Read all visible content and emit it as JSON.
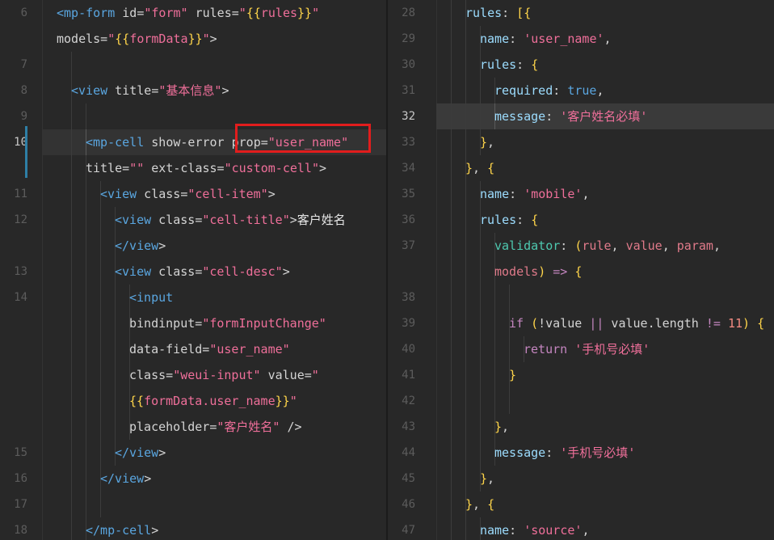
{
  "left": {
    "lines": [
      {
        "ln": "6",
        "active": false,
        "indent": 0,
        "tokens": [
          [
            "tag",
            "<mp-form"
          ],
          [
            "attr",
            " id="
          ],
          [
            "str",
            "\"form\""
          ],
          [
            "attr",
            " rules="
          ],
          [
            "str",
            "\""
          ],
          [
            "brace",
            "{{"
          ],
          [
            "str",
            "rules"
          ],
          [
            "brace",
            "}}"
          ],
          [
            "str",
            "\""
          ]
        ]
      },
      {
        "ln": "",
        "active": false,
        "indent": 0,
        "tokens": [
          [
            "attr",
            "models="
          ],
          [
            "str",
            "\""
          ],
          [
            "brace",
            "{{"
          ],
          [
            "str",
            "formData"
          ],
          [
            "brace",
            "}}"
          ],
          [
            "str",
            "\""
          ],
          [
            "punc",
            ">"
          ]
        ]
      },
      {
        "ln": "7",
        "active": false,
        "indent": 1,
        "tokens": []
      },
      {
        "ln": "8",
        "active": false,
        "indent": 1,
        "tokens": [
          [
            "tag",
            "<view"
          ],
          [
            "attr",
            " title="
          ],
          [
            "str",
            "\"基本信息\""
          ],
          [
            "punc",
            ">"
          ]
        ]
      },
      {
        "ln": "9",
        "active": false,
        "indent": 2,
        "tokens": []
      },
      {
        "ln": "10",
        "active": true,
        "indent": 2,
        "tokens": [
          [
            "tag",
            "<mp-cell"
          ],
          [
            "attr",
            " show-error "
          ],
          [
            "attr",
            "prop="
          ],
          [
            "str",
            "\"user_name\""
          ]
        ]
      },
      {
        "ln": "",
        "active": false,
        "indent": 2,
        "tokens": [
          [
            "attr",
            "title="
          ],
          [
            "str",
            "\"\""
          ],
          [
            "attr",
            " ext-class="
          ],
          [
            "str",
            "\"custom-cell\""
          ],
          [
            "punc",
            ">"
          ]
        ]
      },
      {
        "ln": "11",
        "active": false,
        "indent": 3,
        "tokens": [
          [
            "tag",
            "<view"
          ],
          [
            "attr",
            " class="
          ],
          [
            "str",
            "\"cell-item\""
          ],
          [
            "punc",
            ">"
          ]
        ]
      },
      {
        "ln": "12",
        "active": false,
        "indent": 4,
        "tokens": [
          [
            "tag",
            "<view"
          ],
          [
            "attr",
            " class="
          ],
          [
            "str",
            "\"cell-title\""
          ],
          [
            "punc",
            ">"
          ],
          [
            "cn",
            "客户姓名"
          ]
        ]
      },
      {
        "ln": "",
        "active": false,
        "indent": 4,
        "tokens": [
          [
            "tag",
            "</view"
          ],
          [
            "punc",
            ">"
          ]
        ]
      },
      {
        "ln": "13",
        "active": false,
        "indent": 4,
        "tokens": [
          [
            "tag",
            "<view"
          ],
          [
            "attr",
            " class="
          ],
          [
            "str",
            "\"cell-desc\""
          ],
          [
            "punc",
            ">"
          ]
        ]
      },
      {
        "ln": "14",
        "active": false,
        "indent": 5,
        "tokens": [
          [
            "tag",
            "<input"
          ]
        ]
      },
      {
        "ln": "",
        "active": false,
        "indent": 5,
        "tokens": [
          [
            "attr",
            "bindinput="
          ],
          [
            "str",
            "\"formInputChange\""
          ]
        ]
      },
      {
        "ln": "",
        "active": false,
        "indent": 5,
        "tokens": [
          [
            "attr",
            "data-field="
          ],
          [
            "str",
            "\"user_name\""
          ]
        ]
      },
      {
        "ln": "",
        "active": false,
        "indent": 5,
        "tokens": [
          [
            "attr",
            "class="
          ],
          [
            "str",
            "\"weui-input\""
          ],
          [
            "attr",
            " value="
          ],
          [
            "str",
            "\""
          ]
        ]
      },
      {
        "ln": "",
        "active": false,
        "indent": 5,
        "tokens": [
          [
            "brace",
            "{{"
          ],
          [
            "str",
            "formData.user_name"
          ],
          [
            "brace",
            "}}"
          ],
          [
            "str",
            "\""
          ]
        ]
      },
      {
        "ln": "",
        "active": false,
        "indent": 5,
        "tokens": [
          [
            "attr",
            "placeholder="
          ],
          [
            "str",
            "\"客户姓名\""
          ],
          [
            "punc",
            " />"
          ]
        ]
      },
      {
        "ln": "15",
        "active": false,
        "indent": 4,
        "tokens": [
          [
            "tag",
            "</view"
          ],
          [
            "punc",
            ">"
          ]
        ]
      },
      {
        "ln": "16",
        "active": false,
        "indent": 3,
        "tokens": [
          [
            "tag",
            "</view"
          ],
          [
            "punc",
            ">"
          ]
        ]
      },
      {
        "ln": "17",
        "active": false,
        "indent": 3,
        "tokens": []
      },
      {
        "ln": "18",
        "active": false,
        "indent": 2,
        "tokens": [
          [
            "tag",
            "</mp-cell"
          ],
          [
            "punc",
            ">"
          ]
        ]
      }
    ]
  },
  "right": {
    "lines": [
      {
        "ln": "28",
        "active": false,
        "indent": 2,
        "tokens": [
          [
            "prop",
            "rules"
          ],
          [
            "punc",
            ": "
          ],
          [
            "brace",
            "[{"
          ]
        ]
      },
      {
        "ln": "29",
        "active": false,
        "indent": 3,
        "tokens": [
          [
            "prop",
            "name"
          ],
          [
            "punc",
            ": "
          ],
          [
            "str",
            "'user_name'"
          ],
          [
            "punc",
            ","
          ]
        ]
      },
      {
        "ln": "30",
        "active": false,
        "indent": 3,
        "tokens": [
          [
            "prop",
            "rules"
          ],
          [
            "punc",
            ": "
          ],
          [
            "brace",
            "{"
          ]
        ]
      },
      {
        "ln": "31",
        "active": false,
        "indent": 4,
        "tokens": [
          [
            "prop",
            "required"
          ],
          [
            "punc",
            ": "
          ],
          [
            "bool",
            "true"
          ],
          [
            "punc",
            ","
          ]
        ]
      },
      {
        "ln": "32",
        "active": true,
        "indent": 4,
        "tokens": [
          [
            "prop",
            "message"
          ],
          [
            "punc",
            ": "
          ],
          [
            "str",
            "'客户姓名必填'"
          ]
        ]
      },
      {
        "ln": "33",
        "active": false,
        "indent": 3,
        "tokens": [
          [
            "brace",
            "}"
          ],
          [
            "punc",
            ","
          ]
        ]
      },
      {
        "ln": "34",
        "active": false,
        "indent": 2,
        "tokens": [
          [
            "brace",
            "}"
          ],
          [
            "punc",
            ", "
          ],
          [
            "brace",
            "{"
          ]
        ]
      },
      {
        "ln": "35",
        "active": false,
        "indent": 3,
        "tokens": [
          [
            "prop",
            "name"
          ],
          [
            "punc",
            ": "
          ],
          [
            "str",
            "'mobile'"
          ],
          [
            "punc",
            ","
          ]
        ]
      },
      {
        "ln": "36",
        "active": false,
        "indent": 3,
        "tokens": [
          [
            "prop",
            "rules"
          ],
          [
            "punc",
            ": "
          ],
          [
            "brace",
            "{"
          ]
        ]
      },
      {
        "ln": "37",
        "active": false,
        "indent": 4,
        "tokens": [
          [
            "fn",
            "validator"
          ],
          [
            "punc",
            ": "
          ],
          [
            "brace",
            "("
          ],
          [
            "param",
            "rule"
          ],
          [
            "punc",
            ", "
          ],
          [
            "param",
            "value"
          ],
          [
            "punc",
            ", "
          ],
          [
            "param",
            "param"
          ],
          [
            "punc",
            ","
          ]
        ]
      },
      {
        "ln": "",
        "active": false,
        "indent": 4,
        "tokens": [
          [
            "param",
            "models"
          ],
          [
            "brace",
            ")"
          ],
          [
            "kw",
            " => "
          ],
          [
            "brace",
            "{"
          ]
        ]
      },
      {
        "ln": "38",
        "active": false,
        "indent": 5,
        "tokens": []
      },
      {
        "ln": "39",
        "active": false,
        "indent": 5,
        "tokens": [
          [
            "kw",
            "if"
          ],
          [
            "punc",
            " "
          ],
          [
            "brace",
            "("
          ],
          [
            "punc",
            "!value "
          ],
          [
            "kw",
            "||"
          ],
          [
            "punc",
            " value.length "
          ],
          [
            "kw",
            "!="
          ],
          [
            "punc",
            " "
          ],
          [
            "num",
            "11"
          ],
          [
            "brace",
            ")"
          ],
          [
            "punc",
            " "
          ],
          [
            "brace",
            "{"
          ]
        ]
      },
      {
        "ln": "40",
        "active": false,
        "indent": 6,
        "tokens": [
          [
            "kw",
            "return"
          ],
          [
            "punc",
            " "
          ],
          [
            "str",
            "'手机号必填'"
          ]
        ]
      },
      {
        "ln": "41",
        "active": false,
        "indent": 5,
        "tokens": [
          [
            "brace",
            "}"
          ]
        ]
      },
      {
        "ln": "42",
        "active": false,
        "indent": 5,
        "tokens": []
      },
      {
        "ln": "43",
        "active": false,
        "indent": 4,
        "tokens": [
          [
            "brace",
            "}"
          ],
          [
            "punc",
            ","
          ]
        ]
      },
      {
        "ln": "44",
        "active": false,
        "indent": 4,
        "tokens": [
          [
            "prop",
            "message"
          ],
          [
            "punc",
            ": "
          ],
          [
            "str",
            "'手机号必填'"
          ]
        ]
      },
      {
        "ln": "45",
        "active": false,
        "indent": 3,
        "tokens": [
          [
            "brace",
            "}"
          ],
          [
            "punc",
            ","
          ]
        ]
      },
      {
        "ln": "46",
        "active": false,
        "indent": 2,
        "tokens": [
          [
            "brace",
            "}"
          ],
          [
            "punc",
            ", "
          ],
          [
            "brace",
            "{"
          ]
        ]
      },
      {
        "ln": "47",
        "active": false,
        "indent": 3,
        "tokens": [
          [
            "prop",
            "name"
          ],
          [
            "punc",
            ": "
          ],
          [
            "str",
            "'source'"
          ],
          [
            "punc",
            ","
          ]
        ]
      }
    ]
  },
  "colors": {
    "background": "#282828",
    "line_highlight": "#3a3a3a",
    "annotation_box": "#e11d1d",
    "modified_bar": "#2e7fa6"
  }
}
